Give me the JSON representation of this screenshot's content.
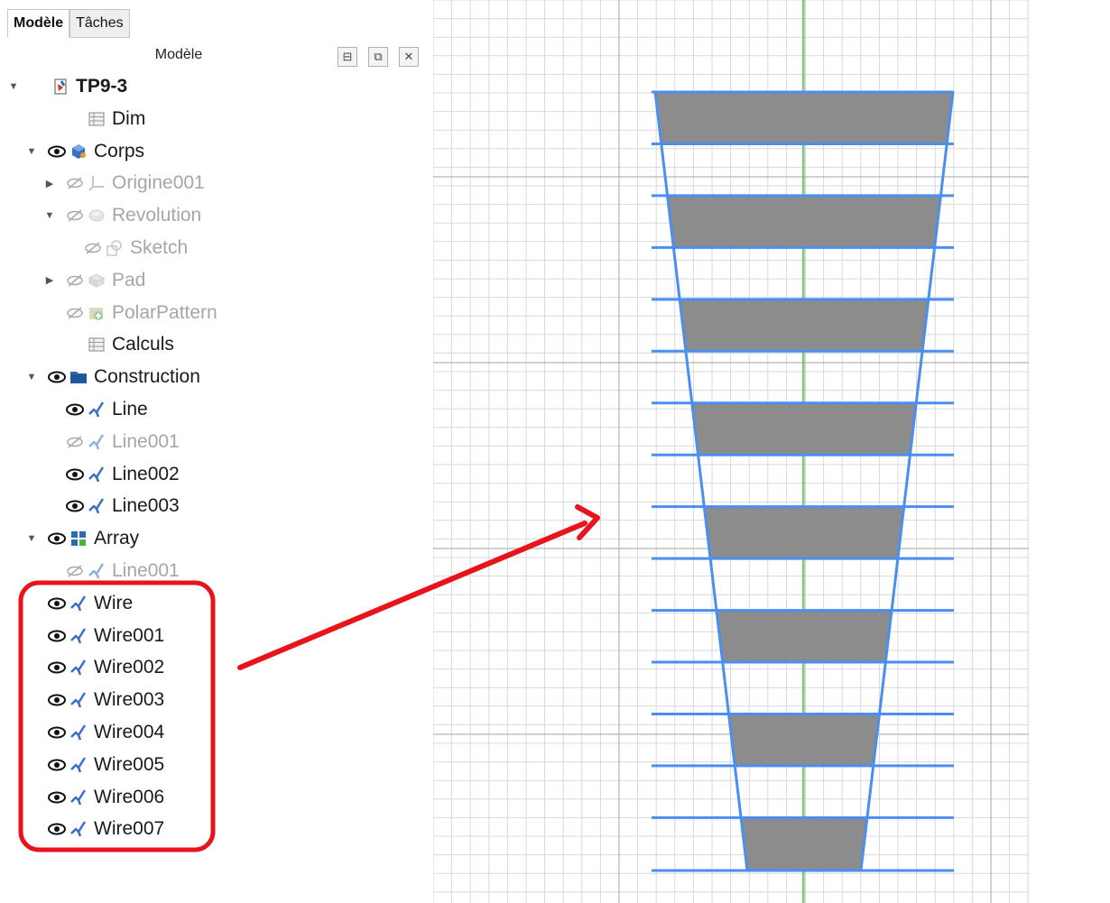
{
  "tabs": [
    {
      "label": "Modèle",
      "active": true
    },
    {
      "label": "Tâches",
      "active": false
    }
  ],
  "panel": {
    "title": "Modèle",
    "buttons": [
      {
        "name": "float-button",
        "glyph": "⊟"
      },
      {
        "name": "undock-button",
        "glyph": "⧉"
      },
      {
        "name": "close-button",
        "glyph": "✕"
      }
    ]
  },
  "tree": [
    {
      "label": "TP9-3",
      "expander": "open",
      "visible": null,
      "icon": "document-icon",
      "indent": 0,
      "bold": true,
      "dim": false
    },
    {
      "label": "Dim",
      "expander": null,
      "visible": null,
      "icon": "spreadsheet-icon",
      "indent": 2,
      "bold": false,
      "dim": false
    },
    {
      "label": "Corps",
      "expander": "open",
      "visible": true,
      "icon": "body-icon",
      "indent": 1,
      "bold": false,
      "dim": false
    },
    {
      "label": "Origine001",
      "expander": "closed",
      "visible": false,
      "icon": "origin-icon",
      "indent": 2,
      "bold": false,
      "dim": true
    },
    {
      "label": "Revolution",
      "expander": "open",
      "visible": false,
      "icon": "revolution-icon",
      "indent": 2,
      "bold": false,
      "dim": true
    },
    {
      "label": "Sketch",
      "expander": null,
      "visible": false,
      "icon": "sketch-icon",
      "indent": 3,
      "bold": false,
      "dim": true
    },
    {
      "label": "Pad",
      "expander": "closed",
      "visible": false,
      "icon": "pad-icon",
      "indent": 2,
      "bold": false,
      "dim": true
    },
    {
      "label": "PolarPattern",
      "expander": null,
      "visible": false,
      "icon": "polar-pattern-icon",
      "indent": 2,
      "bold": false,
      "dim": true
    },
    {
      "label": "Calculs",
      "expander": null,
      "visible": null,
      "icon": "spreadsheet-icon",
      "indent": 2,
      "bold": false,
      "dim": false
    },
    {
      "label": "Construction",
      "expander": "open",
      "visible": true,
      "icon": "folder-icon",
      "indent": 1,
      "bold": false,
      "dim": false
    },
    {
      "label": "Line",
      "expander": null,
      "visible": true,
      "icon": "wire-icon",
      "indent": 2,
      "bold": false,
      "dim": false
    },
    {
      "label": "Line001",
      "expander": null,
      "visible": false,
      "icon": "wire-icon",
      "indent": 2,
      "bold": false,
      "dim": true
    },
    {
      "label": "Line002",
      "expander": null,
      "visible": true,
      "icon": "wire-icon",
      "indent": 2,
      "bold": false,
      "dim": false
    },
    {
      "label": "Line003",
      "expander": null,
      "visible": true,
      "icon": "wire-icon",
      "indent": 2,
      "bold": false,
      "dim": false
    },
    {
      "label": "Array",
      "expander": "open",
      "visible": true,
      "icon": "array-icon",
      "indent": 1,
      "bold": false,
      "dim": false
    },
    {
      "label": "Line001",
      "expander": null,
      "visible": false,
      "icon": "wire-icon",
      "indent": 2,
      "bold": false,
      "dim": true
    },
    {
      "label": "Wire",
      "expander": null,
      "visible": true,
      "icon": "wire-icon",
      "indent": 1,
      "bold": false,
      "dim": false
    },
    {
      "label": "Wire001",
      "expander": null,
      "visible": true,
      "icon": "wire-icon",
      "indent": 1,
      "bold": false,
      "dim": false
    },
    {
      "label": "Wire002",
      "expander": null,
      "visible": true,
      "icon": "wire-icon",
      "indent": 1,
      "bold": false,
      "dim": false
    },
    {
      "label": "Wire003",
      "expander": null,
      "visible": true,
      "icon": "wire-icon",
      "indent": 1,
      "bold": false,
      "dim": false
    },
    {
      "label": "Wire004",
      "expander": null,
      "visible": true,
      "icon": "wire-icon",
      "indent": 1,
      "bold": false,
      "dim": false
    },
    {
      "label": "Wire005",
      "expander": null,
      "visible": true,
      "icon": "wire-icon",
      "indent": 1,
      "bold": false,
      "dim": false
    },
    {
      "label": "Wire006",
      "expander": null,
      "visible": true,
      "icon": "wire-icon",
      "indent": 1,
      "bold": false,
      "dim": false
    },
    {
      "label": "Wire007",
      "expander": null,
      "visible": true,
      "icon": "wire-icon",
      "indent": 1,
      "bold": false,
      "dim": false
    }
  ],
  "annotation": {
    "highlight_color": "#e8141b",
    "arrow_color": "#e8141b"
  },
  "viewport": {
    "grid_minor": "#d9d9d9",
    "grid_major": "#b4b4b4",
    "axis_color": "#3cc43c",
    "wire_color": "#4a8ff0",
    "fill_color": "#8c8c8c",
    "band_count": 8
  }
}
